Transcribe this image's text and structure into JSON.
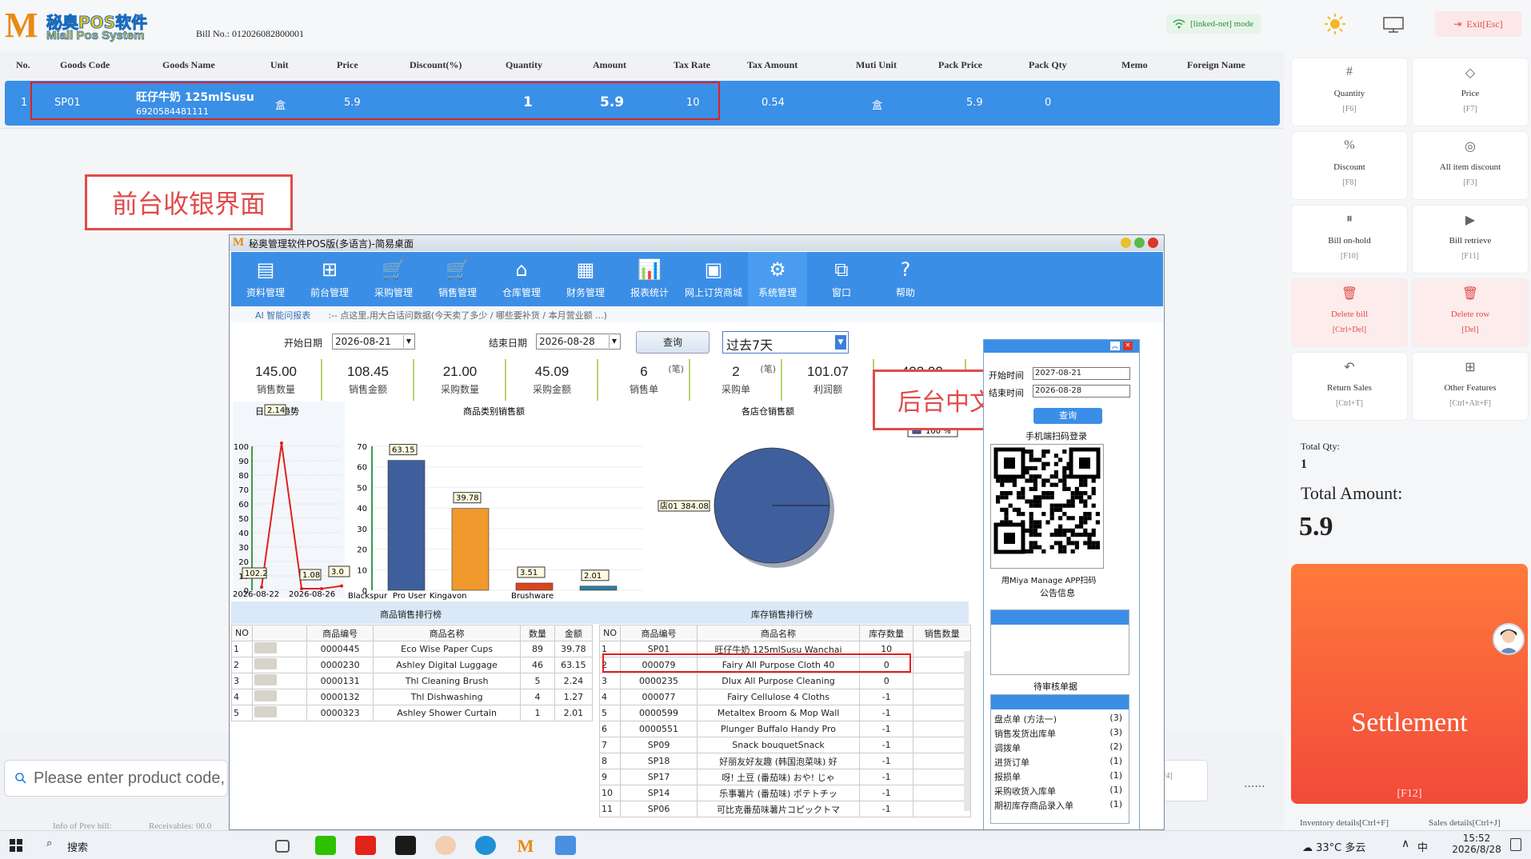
{
  "header": {
    "logo_cn": "秘奥POS软件",
    "logo_en": "Miall Pos System",
    "bill_label": "Bill No.: 012026082800001",
    "net_mode": "[linked-net] mode",
    "exit_label": "Exit[Esc]"
  },
  "columns": [
    "No.",
    "Goods Code",
    "Goods Name",
    "Unit",
    "Price",
    "Discount(%)",
    "Quantity",
    "Amount",
    "Tax Rate",
    "Tax Amount",
    "Muti Unit",
    "Pack Price",
    "Pack Qty",
    "Memo",
    "Foreign Name"
  ],
  "cart_row": {
    "no": "1",
    "code": "SP01",
    "name": "旺仔牛奶 125mlSusu",
    "barcode": "6920584481111",
    "unit": "盒",
    "price": "5.9",
    "quantity": "1",
    "amount": "5.9",
    "tax_rate": "10",
    "tax_amount": "0.54",
    "muti_unit": "盒",
    "pack_price": "5.9",
    "pack_qty": "0"
  },
  "labels": {
    "front": "前台收银界面",
    "back": "后台中文界面"
  },
  "search": {
    "placeholder": "Please enter product code,"
  },
  "search_ext": "F4]",
  "footer": {
    "prev_bill": "Info of Prev bill:",
    "receivables": "Receivables: 00.0",
    "inventory": "Inventory details[Ctrl+F]",
    "sales": "Sales details[Ctrl+J]"
  },
  "function_keys": [
    {
      "icon": "#",
      "label": "Quantity",
      "key": "[F6]"
    },
    {
      "icon": "◇",
      "label": "Price",
      "key": "[F7]"
    },
    {
      "icon": "%",
      "label": "Discount",
      "key": "[F8]"
    },
    {
      "icon": "",
      "label": "All item discount",
      "key": "[F3]"
    },
    {
      "icon": "⏸",
      "label": "Bill on-hold",
      "key": "[F10]"
    },
    {
      "icon": "▶",
      "label": "Bill retrieve",
      "key": "[F11]"
    },
    {
      "icon": "🗑",
      "label": "Delete bill",
      "key": "[Ctrl+Del]"
    },
    {
      "icon": "🗑",
      "label": "Delete row",
      "key": "[Del]"
    },
    {
      "icon": "↶",
      "label": "Return Sales",
      "key": "[Ctrl+T]"
    },
    {
      "icon": "⊞",
      "label": "Other Features",
      "key": "[Ctrl+Alt+F]"
    }
  ],
  "totals": {
    "qty_label": "Total Qty:",
    "qty": "1",
    "amount_label": "Total Amount:",
    "amount": "5.9"
  },
  "settlement": {
    "label": "Settlement",
    "key": "[F12]"
  },
  "backend": {
    "title": "秘奥管理软件POS版(多语言)-简易桌面",
    "toolbar": [
      "资料管理",
      "前台管理",
      "采购管理",
      "销售管理",
      "仓库管理",
      "财务管理",
      "报表统计",
      "网上订货商城",
      "系统管理",
      "窗口",
      "帮助"
    ],
    "ai_label": "AI 智能问报表",
    "ai_hint": ":-- 点这里,用大白话问数据(今天卖了多少 / 哪些要补货 / 本月营业额 ...)",
    "start_label": "开始日期",
    "start_date": "2026-08-21",
    "end_label": "结束日期",
    "end_date": "2026-08-28",
    "query": "查询",
    "period": "过去7天",
    "kpis": [
      {
        "value": "145.00",
        "label": "销售数量",
        "unit": ""
      },
      {
        "value": "108.45",
        "label": "销售金额",
        "unit": ""
      },
      {
        "value": "21.00",
        "label": "采购数量",
        "unit": ""
      },
      {
        "value": "45.09",
        "label": "采购金额",
        "unit": ""
      },
      {
        "value": "6",
        "label": "销售单",
        "unit": "(笔)"
      },
      {
        "value": "2",
        "label": "采购单",
        "unit": "(笔)"
      },
      {
        "value": "101.07",
        "label": "利润额",
        "unit": ""
      },
      {
        "value": "-402.00",
        "label": "库存数",
        "unit": ""
      }
    ],
    "left_rank_title": "商品销售排行榜",
    "right_rank_title": "库存销售排行榜",
    "left_rank_headers": [
      "NO",
      "",
      "商品编号",
      "商品名称",
      "数量",
      "金额"
    ],
    "left_rank": [
      [
        "1",
        "0000445",
        "Eco Wise Paper Cups",
        "89",
        "39.78"
      ],
      [
        "2",
        "0000230",
        "Ashley Digital Luggage",
        "46",
        "63.15"
      ],
      [
        "3",
        "0000131",
        "Thl Cleaning Brush",
        "5",
        "2.24"
      ],
      [
        "4",
        "0000132",
        "Thl Dishwashing",
        "4",
        "1.27"
      ],
      [
        "5",
        "0000323",
        "Ashley Shower Curtain",
        "1",
        "2.01"
      ]
    ],
    "right_rank_headers": [
      "NO",
      "商品编号",
      "商品名称",
      "库存数量",
      "销售数量"
    ],
    "right_rank": [
      [
        "1",
        "SP01",
        "旺仔牛奶 125mlSusu Wanchai",
        "10",
        ""
      ],
      [
        "2",
        "000079",
        "Fairy All Purpose Cloth 40",
        "0",
        ""
      ],
      [
        "3",
        "0000235",
        "Dlux All Purpose Cleaning",
        "0",
        ""
      ],
      [
        "4",
        "000077",
        "Fairy Cellulose 4 Cloths",
        "-1",
        ""
      ],
      [
        "5",
        "0000599",
        "Metaltex Broom & Mop Wall",
        "-1",
        ""
      ],
      [
        "6",
        "0000551",
        "Plunger Buffalo Handy Pro",
        "-1",
        ""
      ],
      [
        "7",
        "SP09",
        "Snack bouquetSnack",
        "-1",
        ""
      ],
      [
        "8",
        "SP18",
        "好丽友好友趣 (韩国泡菜味) 好",
        "-1",
        ""
      ],
      [
        "9",
        "SP17",
        "呀! 土豆 (番茄味) おや! じゃ",
        "-1",
        ""
      ],
      [
        "10",
        "SP14",
        "乐事薯片 (番茄味) ポテトチッ",
        "-1",
        ""
      ],
      [
        "11",
        "SP06",
        "可比克番茄味薯片コピックトマ",
        "-1",
        ""
      ]
    ],
    "popup": {
      "start_label": "开始时间",
      "start": "2027-08-21",
      "end_label": "结束时间",
      "end": "2026-08-28",
      "query": "查询",
      "qr_title": "手机端扫码登录",
      "qr_caption": "用Miya Manage APP扫码",
      "announce": "公告信息",
      "pending": "待审核单据",
      "pending_items": [
        [
          "盘点单 (方法一)",
          "(3)"
        ],
        [
          "销售发货出库单",
          "(3)"
        ],
        [
          "调拨单",
          "(2)"
        ],
        [
          "进货订单",
          "(1)"
        ],
        [
          "报损单",
          "(1)"
        ],
        [
          "采购收货入库单",
          "(1)"
        ],
        [
          "期初库存商品录入单",
          "(1)"
        ]
      ]
    }
  },
  "chart_data": [
    {
      "type": "line",
      "title": "日销售趋势",
      "x": [
        "2026-08-21",
        "2026-08-22",
        "2026-08-24",
        "2026-08-26",
        "2026-08-28"
      ],
      "values": [
        2.14,
        102.2,
        1.08,
        1.08,
        3.0
      ],
      "point_labels": [
        "2.14",
        "102.2",
        "1.08",
        "3.0"
      ],
      "xticks": [
        "2026-08-22",
        "2026-08-26"
      ],
      "ylim": [
        0,
        100
      ],
      "yticks": [
        0,
        10,
        20,
        30,
        40,
        50,
        60,
        70,
        80,
        90,
        100
      ],
      "color": "#e02020"
    },
    {
      "type": "bar",
      "title": "商品类别销售额",
      "categories": [
        "Blackspur",
        "Pro User",
        "Kingavon",
        "",
        "Brushware",
        ""
      ],
      "bars": [
        {
          "label": "63.15",
          "value": 63.15,
          "color": "#3f5f9c"
        },
        {
          "label": "39.78",
          "value": 39.78,
          "color": "#f0992d"
        },
        {
          "label": "3.51",
          "value": 3.51,
          "color": "#d9451f"
        },
        {
          "label": "2.01",
          "value": 2.01,
          "color": "#2e7f9e"
        }
      ],
      "ylim": [
        0,
        70
      ],
      "yticks": [
        0,
        10,
        20,
        30,
        40,
        50,
        60,
        70
      ]
    },
    {
      "type": "pie",
      "title": "各店仓销售额",
      "slices": [
        {
          "label": "店01 384.08",
          "value": 100,
          "color": "#3f5f9c"
        }
      ],
      "legend": "100 %"
    }
  ],
  "taskbar": {
    "search": "搜索",
    "weather": "33°C 多云",
    "ime": "中",
    "time": "15:52",
    "date": "2026/8/28"
  }
}
